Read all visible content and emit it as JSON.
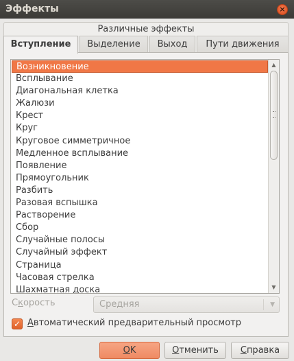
{
  "window": {
    "title": "Эффекты",
    "close_icon": "close-icon"
  },
  "group": {
    "title": "Различные эффекты"
  },
  "tabs": [
    {
      "label": "Вступление",
      "active": true
    },
    {
      "label": "Выделение",
      "active": false
    },
    {
      "label": "Выход",
      "active": false
    },
    {
      "label": "Пути движения",
      "active": false
    }
  ],
  "effects": {
    "selected_index": 0,
    "items": [
      "Возникновение",
      "Всплывание",
      "Диагональная клетка",
      "Жалюзи",
      "Крест",
      "Круг",
      "Круговое симметричное",
      "Медленное всплывание",
      "Появление",
      "Прямоугольник",
      "Разбить",
      "Разовая вспышка",
      "Растворение",
      "Сбор",
      "Случайные полосы",
      "Случайный эффект",
      "Страница",
      "Часовая стрелка",
      "Шахматная доска"
    ]
  },
  "speed": {
    "label_first": "С",
    "label_underlined": "к",
    "label_rest": "орость",
    "value": "Средняя",
    "enabled": false
  },
  "autopreview": {
    "checked": true,
    "label_underlined": "А",
    "label_rest": "втоматический предварительный просмотр"
  },
  "buttons": {
    "ok_underlined": "О",
    "ok_rest": "K",
    "cancel_underlined": "О",
    "cancel_rest": "тменить",
    "help_underlined": "С",
    "help_rest": "правка"
  },
  "colors": {
    "accent": "#f07746",
    "titlebar": "#3c3b37",
    "window_bg": "#e9e8e6"
  }
}
